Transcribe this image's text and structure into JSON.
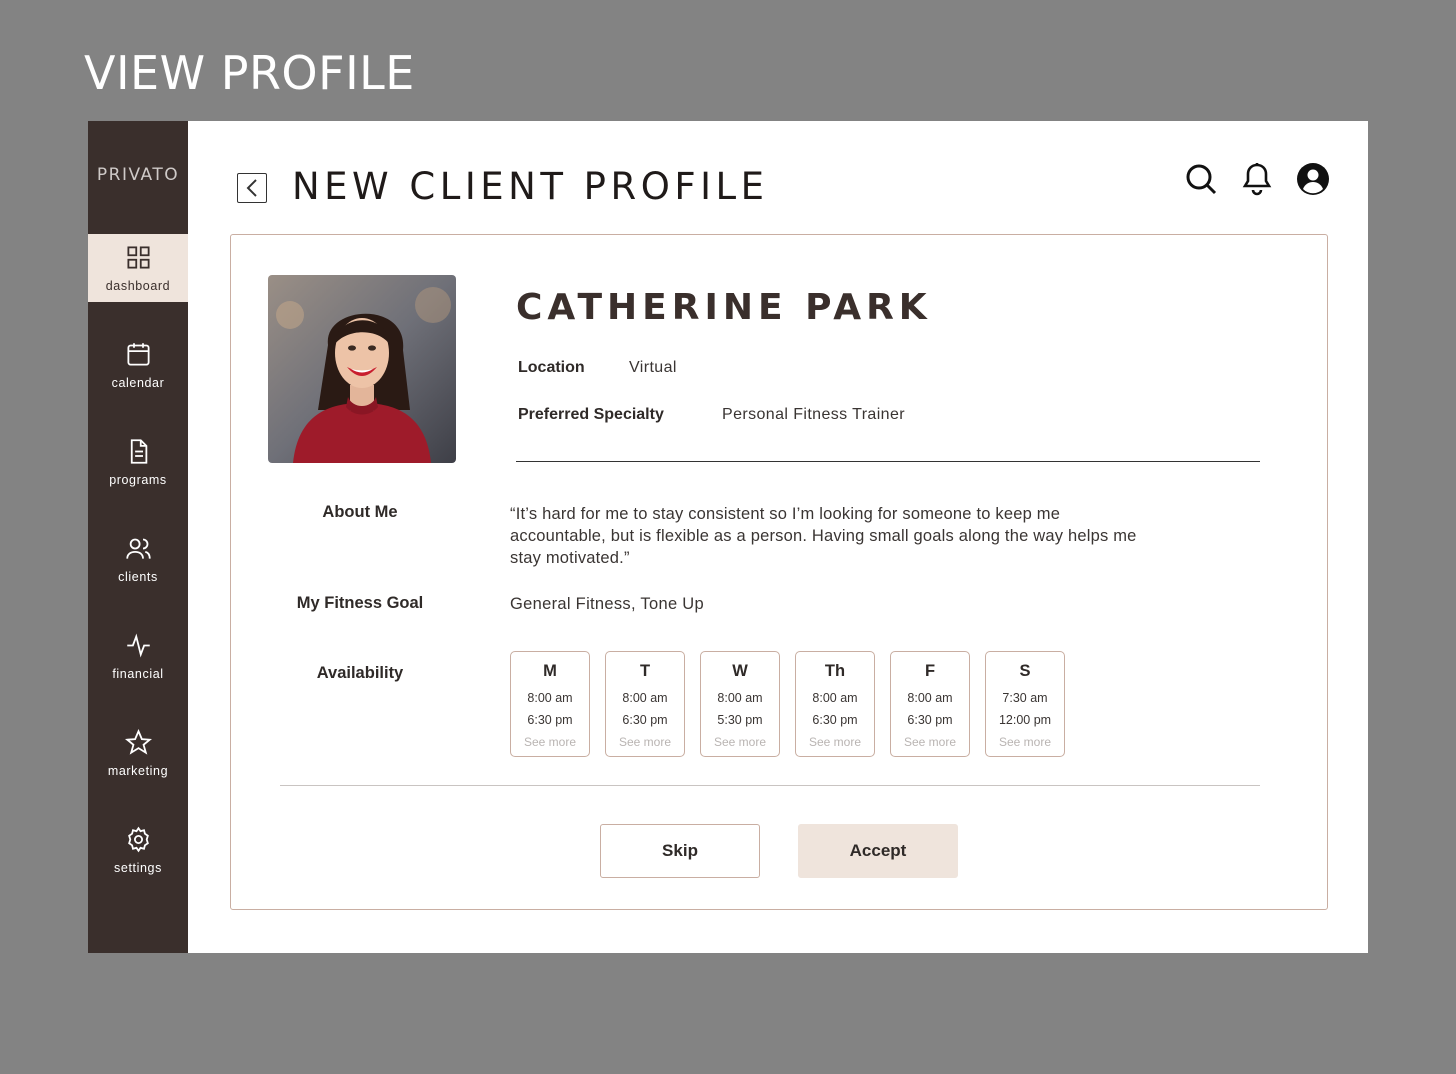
{
  "view_title": "VIEW PROFILE",
  "brand": {
    "logo": "PRIVATO",
    "accent": "#efe4dc",
    "sidebar_bg": "#3a2f2c",
    "border": "#c9aea2"
  },
  "sidebar": {
    "items": [
      {
        "label": "dashboard",
        "icon": "grid-icon",
        "active": true
      },
      {
        "label": "calendar",
        "icon": "calendar-icon",
        "active": false
      },
      {
        "label": "programs",
        "icon": "document-icon",
        "active": false
      },
      {
        "label": "clients",
        "icon": "users-icon",
        "active": false
      },
      {
        "label": "financial",
        "icon": "activity-icon",
        "active": false
      },
      {
        "label": "marketing",
        "icon": "star-icon",
        "active": false
      },
      {
        "label": "settings",
        "icon": "gear-icon",
        "active": false
      }
    ]
  },
  "header": {
    "title": "NEW CLIENT PROFILE",
    "icons": [
      "search-icon",
      "bell-icon",
      "user-icon"
    ]
  },
  "profile": {
    "name": "CATHERINE PARK",
    "location_label": "Location",
    "location_value": "Virtual",
    "specialty_label": "Preferred Specialty",
    "specialty_value": "Personal Fitness Trainer",
    "about_label": "About Me",
    "about_text": "“It’s hard for me to stay consistent so I’m looking for someone to keep me accountable, but is flexible as a person. Having small goals along the way helps me stay motivated.”",
    "goal_label": "My Fitness Goal",
    "goal_text": "General Fitness, Tone Up",
    "availability_label": "Availability",
    "availability": [
      {
        "day": "M",
        "start": "8:00 am",
        "end": "6:30 pm",
        "more": "See more"
      },
      {
        "day": "T",
        "start": "8:00 am",
        "end": "6:30 pm",
        "more": "See more"
      },
      {
        "day": "W",
        "start": "8:00 am",
        "end": "5:30 pm",
        "more": "See more"
      },
      {
        "day": "Th",
        "start": "8:00 am",
        "end": "6:30 pm",
        "more": "See more"
      },
      {
        "day": "F",
        "start": "8:00 am",
        "end": "6:30 pm",
        "more": "See more"
      },
      {
        "day": "S",
        "start": "7:30 am",
        "end": "12:00 pm",
        "more": "See more"
      }
    ]
  },
  "actions": {
    "skip_label": "Skip",
    "accept_label": "Accept"
  }
}
